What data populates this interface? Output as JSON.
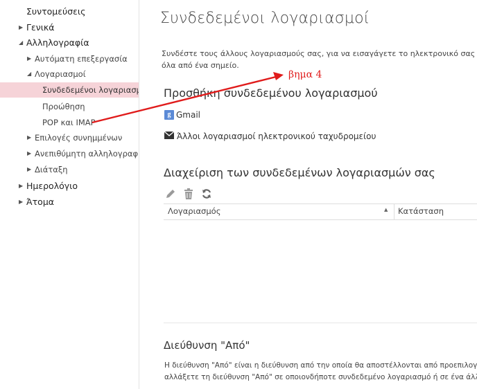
{
  "sidebar": {
    "items": [
      {
        "label": "Συντομεύσεις",
        "level": 0,
        "arrow": ""
      },
      {
        "label": "Γενικά",
        "level": 0,
        "arrow": "collapsed"
      },
      {
        "label": "Αλληλογραφία",
        "level": 0,
        "arrow": "expanded"
      },
      {
        "label": "Αυτόματη επεξεργασία",
        "level": 1,
        "arrow": "collapsed"
      },
      {
        "label": "Λογαριασμοί",
        "level": 1,
        "arrow": "expanded"
      },
      {
        "label": "Συνδεδεμένοι λογαριασμοί",
        "level": 2,
        "arrow": "",
        "selected": true
      },
      {
        "label": "Προώθηση",
        "level": 2,
        "arrow": ""
      },
      {
        "label": "POP και IMAP",
        "level": 2,
        "arrow": ""
      },
      {
        "label": "Επιλογές συνημμένων",
        "level": 1,
        "arrow": "collapsed"
      },
      {
        "label": "Ανεπιθύμητη αλληλογραφία",
        "level": 1,
        "arrow": "collapsed"
      },
      {
        "label": "Διάταξη",
        "level": 1,
        "arrow": "collapsed"
      },
      {
        "label": "Ημερολόγιο",
        "level": 0,
        "arrow": "collapsed"
      },
      {
        "label": "Άτομα",
        "level": 0,
        "arrow": "collapsed"
      }
    ]
  },
  "main": {
    "title": "Συνδεδεμένοι λογαριασμοί",
    "description_line1": "Συνδέστε τους άλλους λογαριασμούς σας, για να εισαγάγετε το ηλεκτρονικό σας ταχυδρομείο",
    "description_line2": "όλα από ένα σημείο.",
    "add_section_title": "Προσθήκη συνδεδεμένου λογαριασμού",
    "providers": [
      {
        "label": "Gmail",
        "icon": "google-icon",
        "icon_glyph": "g"
      },
      {
        "label": "Άλλοι λογαριασμοί ηλεκτρονικού ταχυδρομείου",
        "icon": "envelope-icon"
      }
    ],
    "manage_section_title": "Διαχείριση των συνδεδεμένων λογαριασμών σας",
    "toolbar_icons": [
      "edit-icon",
      "delete-icon",
      "refresh-icon"
    ],
    "table": {
      "columns": [
        "Λογαριασμός",
        "Κατάσταση"
      ],
      "rows": []
    },
    "from_section_title": "Διεύθυνση \"Από\"",
    "from_desc_line1": "Η διεύθυνση \"Από\" είναι η διεύθυνση από την οποία θα αποστέλλονται από προεπιλογή",
    "from_desc_line2": "αλλάξετε τη διεύθυνση \"Από\" σε οποιονδήποτε συνδεδεμένο λογαριασμό ή σε ένα άλλο"
  },
  "annotation": {
    "text": "βημα 4",
    "color": "#e01b1b"
  },
  "colors": {
    "selected_bg": "#f6d3d8",
    "accent_google": "#5b8ad6"
  }
}
